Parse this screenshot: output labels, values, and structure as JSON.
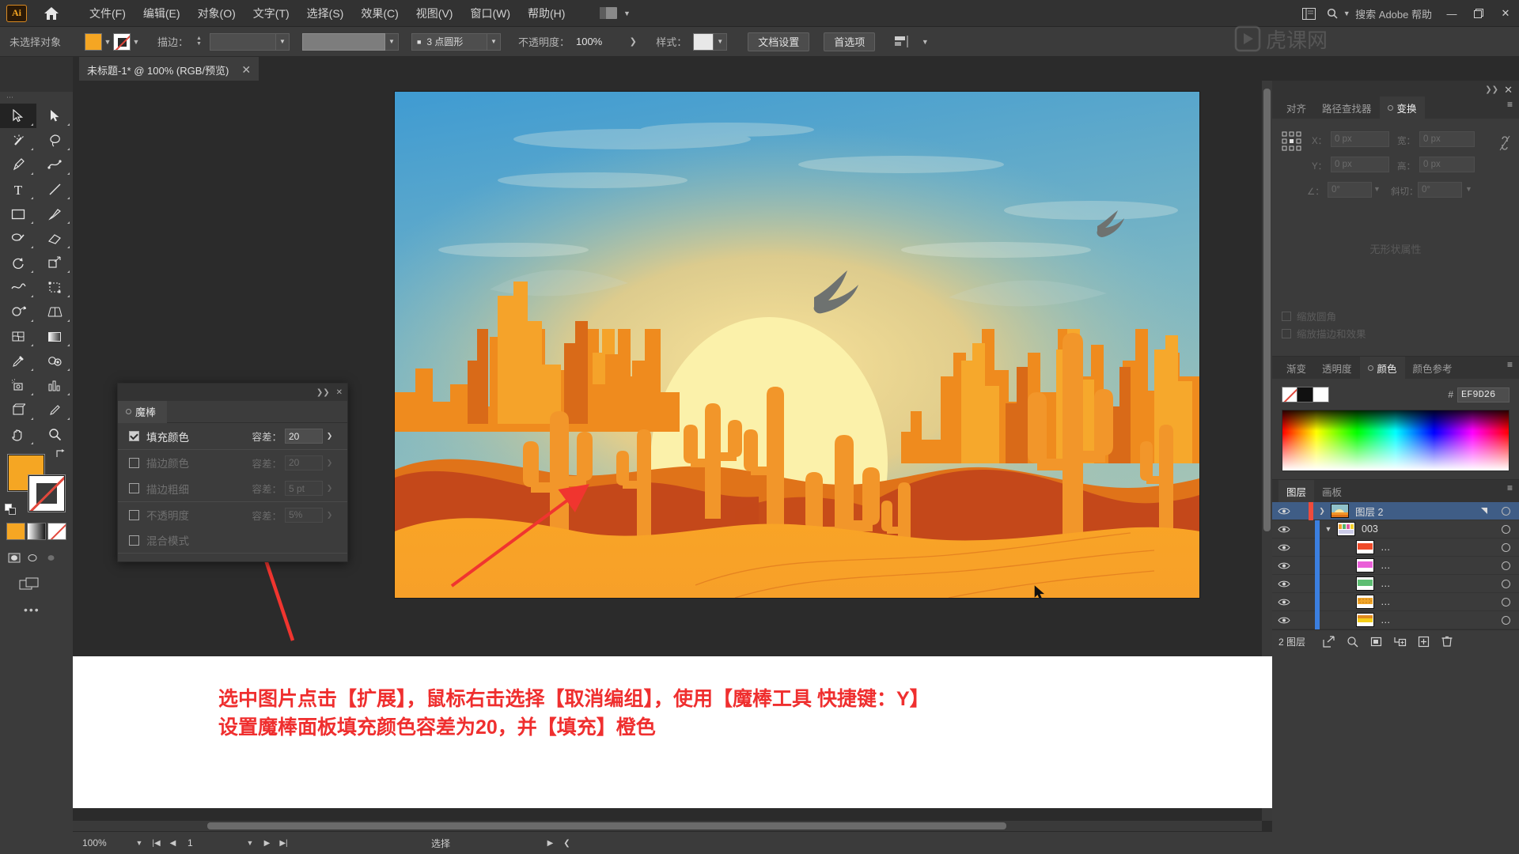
{
  "app": {
    "logo": "Ai",
    "menus": [
      "文件(F)",
      "编辑(E)",
      "对象(O)",
      "文字(T)",
      "选择(S)",
      "效果(C)",
      "视图(V)",
      "窗口(W)",
      "帮助(H)"
    ],
    "search_placeholder": "搜索 Adobe 帮助"
  },
  "controlbar": {
    "selection_status": "未选择对象",
    "fill_color": "#F5A623",
    "stroke_label": "描边：",
    "stroke_weight": "",
    "stroke_profile": "3 点圆形",
    "opacity_label": "不透明度：",
    "opacity_value": "100%",
    "style_label": "样式：",
    "doc_setup": "文档设置",
    "preferences": "首选项"
  },
  "document": {
    "tab_title": "未标题-1* @ 100% (RGB/预览)"
  },
  "magic_wand": {
    "panel_title": "魔棒",
    "rows": [
      {
        "label": "填充颜色",
        "checked": true,
        "tol_label": "容差：",
        "tol_value": "20",
        "enabled": true
      },
      {
        "label": "描边颜色",
        "checked": false,
        "tol_label": "容差：",
        "tol_value": "20",
        "enabled": false
      },
      {
        "label": "描边粗细",
        "checked": false,
        "tol_label": "容差：",
        "tol_value": "5 pt",
        "enabled": false
      },
      {
        "label": "不透明度",
        "checked": false,
        "tol_label": "容差：",
        "tol_value": "5%",
        "enabled": false
      },
      {
        "label": "混合模式",
        "checked": false,
        "tol_label": "",
        "tol_value": "",
        "enabled": false
      }
    ]
  },
  "transform_panel": {
    "tabs": [
      {
        "label": "对齐",
        "active": false
      },
      {
        "label": "路径查找器",
        "active": false
      },
      {
        "label": "变换",
        "active": true
      }
    ],
    "fields": [
      {
        "label": "X：",
        "value": "0 px"
      },
      {
        "label": "Y：",
        "value": "0 px"
      },
      {
        "label": "宽：",
        "value": "0 px"
      },
      {
        "label": "高：",
        "value": "0 px"
      },
      {
        "label": "∠：",
        "value": "0°"
      },
      {
        "label": "斜切：",
        "value": "0°"
      }
    ],
    "empty_text": "无形状属性",
    "options": [
      "缩放圆角",
      "缩放描边和效果"
    ]
  },
  "color_panel": {
    "tabs": [
      {
        "label": "渐变",
        "active": false
      },
      {
        "label": "透明度",
        "active": false
      },
      {
        "label": "颜色",
        "active": true
      },
      {
        "label": "颜色参考",
        "active": false
      }
    ],
    "hex_symbol": "#",
    "hex_value": "EF9D26"
  },
  "layers_panel": {
    "tabs": [
      {
        "label": "图层",
        "active": true
      },
      {
        "label": "画板",
        "active": false
      }
    ],
    "rows": [
      {
        "name": "图层 2",
        "indent": 0,
        "selected": true,
        "expandable": true,
        "expanded": false,
        "thumb": "sunset",
        "color": "#ef4b3c"
      },
      {
        "name": "003",
        "indent": 1,
        "selected": false,
        "expandable": true,
        "expanded": true,
        "thumb": "multi",
        "color": "#3b7fe0"
      },
      {
        "name": "…",
        "indent": 2,
        "selected": false,
        "expandable": false,
        "expanded": false,
        "thumb": "red",
        "color": "#3b7fe0"
      },
      {
        "name": "…",
        "indent": 2,
        "selected": false,
        "expandable": false,
        "expanded": false,
        "thumb": "magenta",
        "color": "#3b7fe0"
      },
      {
        "name": "…",
        "indent": 2,
        "selected": false,
        "expandable": false,
        "expanded": false,
        "thumb": "green",
        "color": "#3b7fe0"
      },
      {
        "name": "…",
        "indent": 2,
        "selected": false,
        "expandable": false,
        "expanded": false,
        "thumb": "orange",
        "color": "#3b7fe0"
      },
      {
        "name": "…",
        "indent": 2,
        "selected": false,
        "expandable": false,
        "expanded": false,
        "thumb": "yellow",
        "color": "#3b7fe0"
      }
    ],
    "footer_count": "2 图层"
  },
  "statusbar": {
    "zoom": "100%",
    "page": "1",
    "mode": "选择"
  },
  "annotation": {
    "line1": "选中图片点击【扩展】，鼠标右击选择【取消编组】，使用【魔棒工具 快捷键：Y】",
    "line2": "设置魔棒面板填充颜色容差为20，并【填充】橙色",
    "color": "#EF2F2F"
  },
  "artwork": {
    "title": "desert-sunset-illustration",
    "colors": {
      "sky_top": "#4b9fd0",
      "sky_mid": "#8fc0bf",
      "sun_glow": "#f3d98a",
      "sun": "#faf0a8",
      "mesa_light": "#f6a22a",
      "mesa_mid": "#ef8018",
      "mesa_dark": "#d45a16",
      "dune_dark": "#c0461a",
      "sand": "#f9a227",
      "cactus": "#f2962a",
      "bird": "#6b6f6e"
    }
  }
}
